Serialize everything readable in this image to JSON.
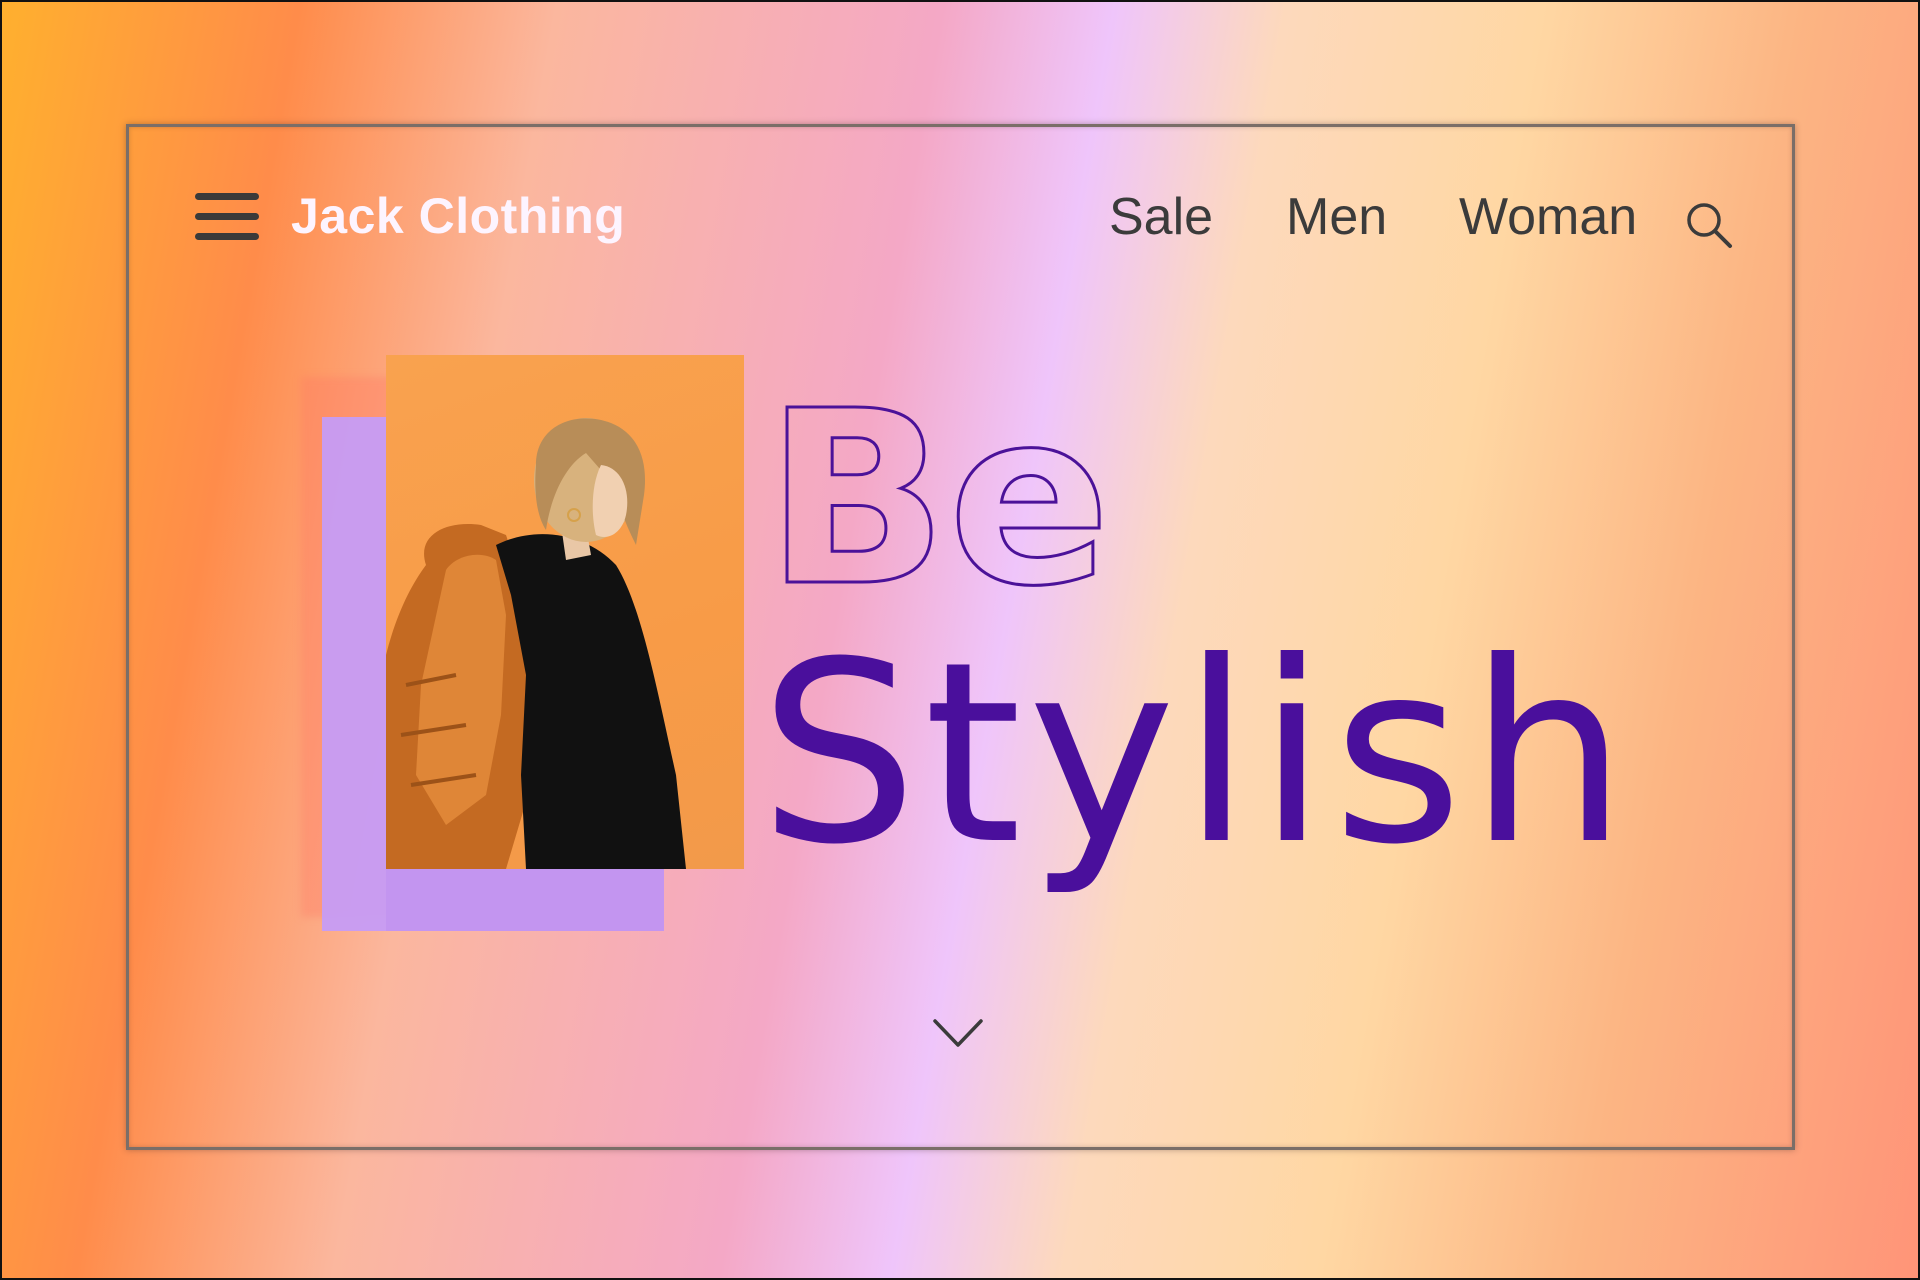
{
  "header": {
    "brand": "Jack Clothing",
    "nav": [
      {
        "label": "Sale"
      },
      {
        "label": "Men"
      },
      {
        "label": "Woman"
      }
    ],
    "menu_icon": "hamburger-menu-icon",
    "search_icon": "search-icon"
  },
  "hero": {
    "line1": "Be",
    "line2": "Stylish",
    "scroll_icon": "chevron-down-icon"
  },
  "colors": {
    "hero_text": "#4a0f9c",
    "brand_text": "#fdf4ff",
    "nav_text": "#3b3b3b",
    "accent_panel": "#c69cf5"
  }
}
